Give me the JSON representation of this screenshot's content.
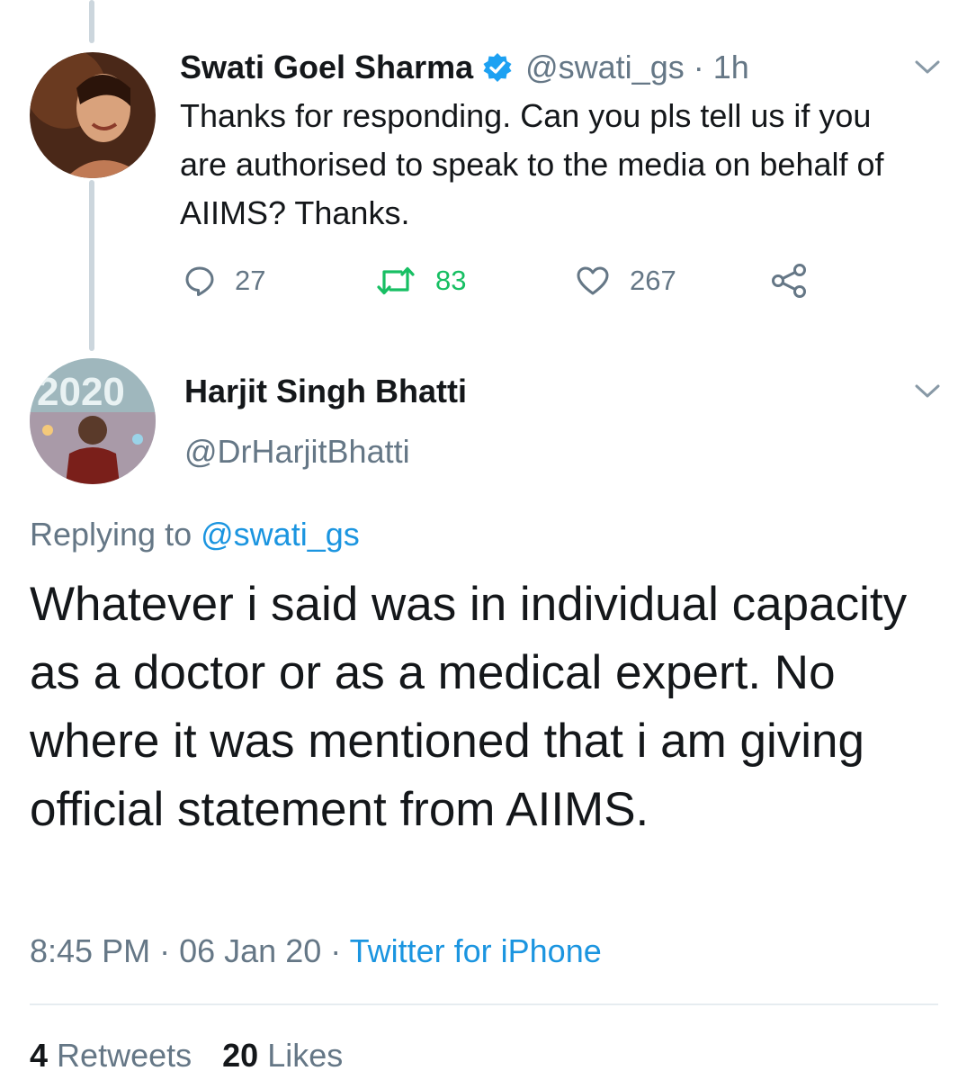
{
  "reply_tweet": {
    "display_name": "Swati Goel Sharma",
    "handle": "@swati_gs",
    "separator": "·",
    "time_ago": "1h",
    "text": "Thanks for responding. Can you pls tell us if you are authorised to speak to the media on behalf of AIIMS? Thanks.",
    "reply_count": "27",
    "retweet_count": "83",
    "like_count": "267"
  },
  "main_tweet": {
    "display_name": "Harjit Singh Bhatti",
    "handle": "@DrHarjitBhatti",
    "replying_prefix": "Replying to",
    "replying_handle": "@swati_gs",
    "text": "Whatever i said was in individual capacity as a doctor or as a medical expert. No where it was mentioned that i am giving official statement from AIIMS.",
    "time": "8:45 PM",
    "separator": "·",
    "date": "06 Jan 20",
    "separator2": "·",
    "source": "Twitter for iPhone",
    "retweets_count": "4",
    "retweets_label": "Retweets",
    "likes_count": "20",
    "likes_label": "Likes"
  },
  "colors": {
    "accent": "#1b95e0",
    "retweet_green": "#17bf63",
    "secondary_text": "#657786",
    "thread_line": "#ccd6dd"
  }
}
